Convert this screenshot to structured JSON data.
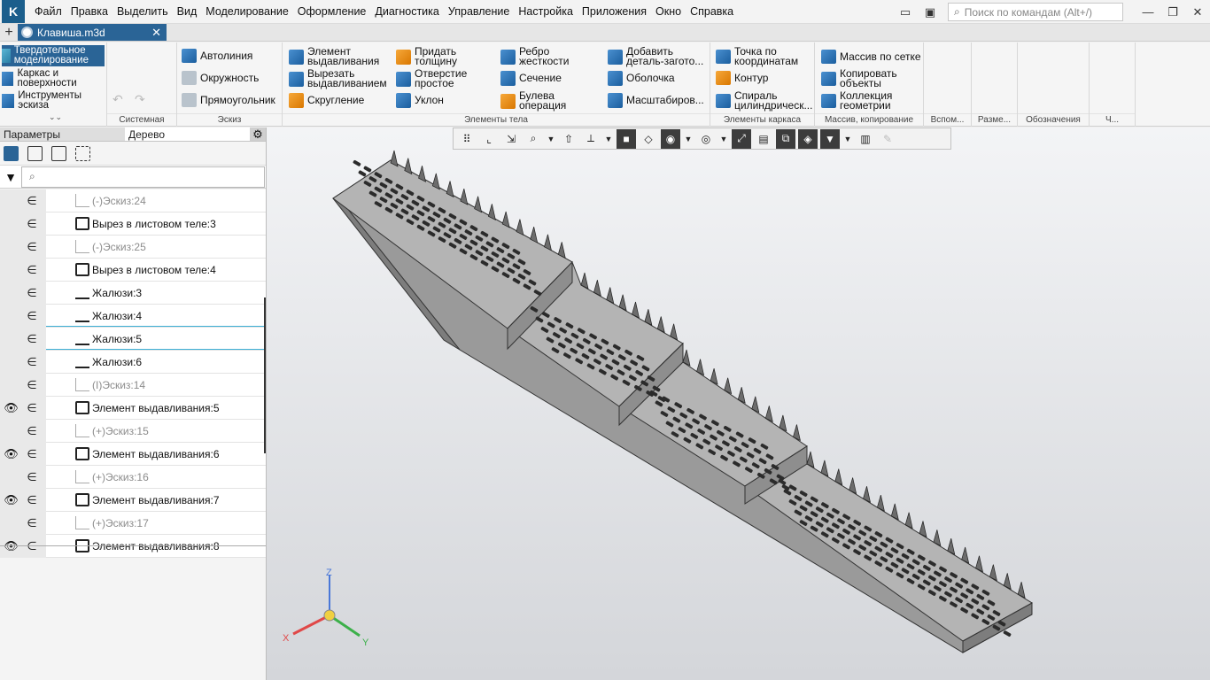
{
  "menu": {
    "items": [
      "Файл",
      "Правка",
      "Выделить",
      "Вид",
      "Моделирование",
      "Оформление",
      "Диагностика",
      "Управление",
      "Настройка",
      "Приложения",
      "Окно",
      "Справка"
    ],
    "search_placeholder": "Поиск по командам (Alt+/)"
  },
  "tab": {
    "title": "Клавиша.m3d"
  },
  "ribbon": {
    "modes": [
      "Твердотельное моделирование",
      "Каркас и поверхности",
      "Инструменты эскиза"
    ],
    "groups": {
      "system": "Системная",
      "sketch": "Эскиз",
      "body": "Элементы тела",
      "frame": "Элементы каркаса",
      "array": "Массив, копирование",
      "aux": "Вспом...",
      "dims": "Разме...",
      "marks": "Обозначения",
      "last": "Ч..."
    },
    "sketch_buttons": [
      "Автолиния",
      "Окружность",
      "Прямоугольник"
    ],
    "body_col1": [
      "Элемент выдавливания",
      "Вырезать выдавливанием",
      "Скругление"
    ],
    "body_col2": [
      "Придать толщину",
      "Отверстие простое",
      "Уклон"
    ],
    "body_col3": [
      "Ребро жесткости",
      "Сечение",
      "Булева операция"
    ],
    "body_col4": [
      "Добавить деталь-загото...",
      "Оболочка",
      "Масштабиров..."
    ],
    "frame_buttons": [
      "Точка по координатам",
      "Контур",
      "Спираль цилиндрическ..."
    ],
    "array_buttons": [
      "Массив по сетке",
      "Копировать объекты",
      "Коллекция геометрии"
    ]
  },
  "panel": {
    "tabs": [
      "Параметры",
      "Дерево"
    ],
    "search_icon": "search-icon"
  },
  "tree": [
    {
      "label": "Эскиз:24",
      "prefix": "(-)",
      "type": "sketch",
      "eye": false,
      "dim": true
    },
    {
      "label": "Вырез в листовом теле:3",
      "prefix": "",
      "type": "cut",
      "eye": false,
      "dim": false
    },
    {
      "label": "Эскиз:25",
      "prefix": "(-)",
      "type": "sketch",
      "eye": false,
      "dim": true
    },
    {
      "label": "Вырез в листовом теле:4",
      "prefix": "",
      "type": "cut",
      "eye": false,
      "dim": false
    },
    {
      "label": "Жалюзи:3",
      "prefix": "",
      "type": "louver",
      "eye": false,
      "dim": false
    },
    {
      "label": "Жалюзи:4",
      "prefix": "",
      "type": "louver",
      "eye": false,
      "dim": false
    },
    {
      "label": "Жалюзи:5",
      "prefix": "",
      "type": "louver",
      "eye": false,
      "dim": false
    },
    {
      "label": "Жалюзи:6",
      "prefix": "",
      "type": "louver",
      "eye": false,
      "dim": false
    },
    {
      "label": "Эскиз:14",
      "prefix": "(I)",
      "type": "sketch",
      "eye": false,
      "dim": true
    },
    {
      "label": "Элемент выдавливания:5",
      "prefix": "",
      "type": "extrude",
      "eye": true,
      "dim": false
    },
    {
      "label": "Эскиз:15",
      "prefix": "(+)",
      "type": "sketch",
      "eye": false,
      "dim": true
    },
    {
      "label": "Элемент выдавливания:6",
      "prefix": "",
      "type": "extrude",
      "eye": true,
      "dim": false
    },
    {
      "label": "Эскиз:16",
      "prefix": "(+)",
      "type": "sketch",
      "eye": false,
      "dim": true
    },
    {
      "label": "Элемент выдавливания:7",
      "prefix": "",
      "type": "extrude",
      "eye": true,
      "dim": false
    },
    {
      "label": "Эскиз:17",
      "prefix": "(+)",
      "type": "sketch",
      "eye": false,
      "dim": true
    },
    {
      "label": "Элемент выдавливания:8",
      "prefix": "",
      "type": "extrude",
      "eye": true,
      "dim": false
    }
  ],
  "axes": {
    "x": "X",
    "y": "Y",
    "z": "Z"
  },
  "colors": {
    "accent": "#2a6496",
    "model_face": "#9a9a9a",
    "model_side": "#7d7d7d",
    "model_top": "#b4b4b4"
  }
}
